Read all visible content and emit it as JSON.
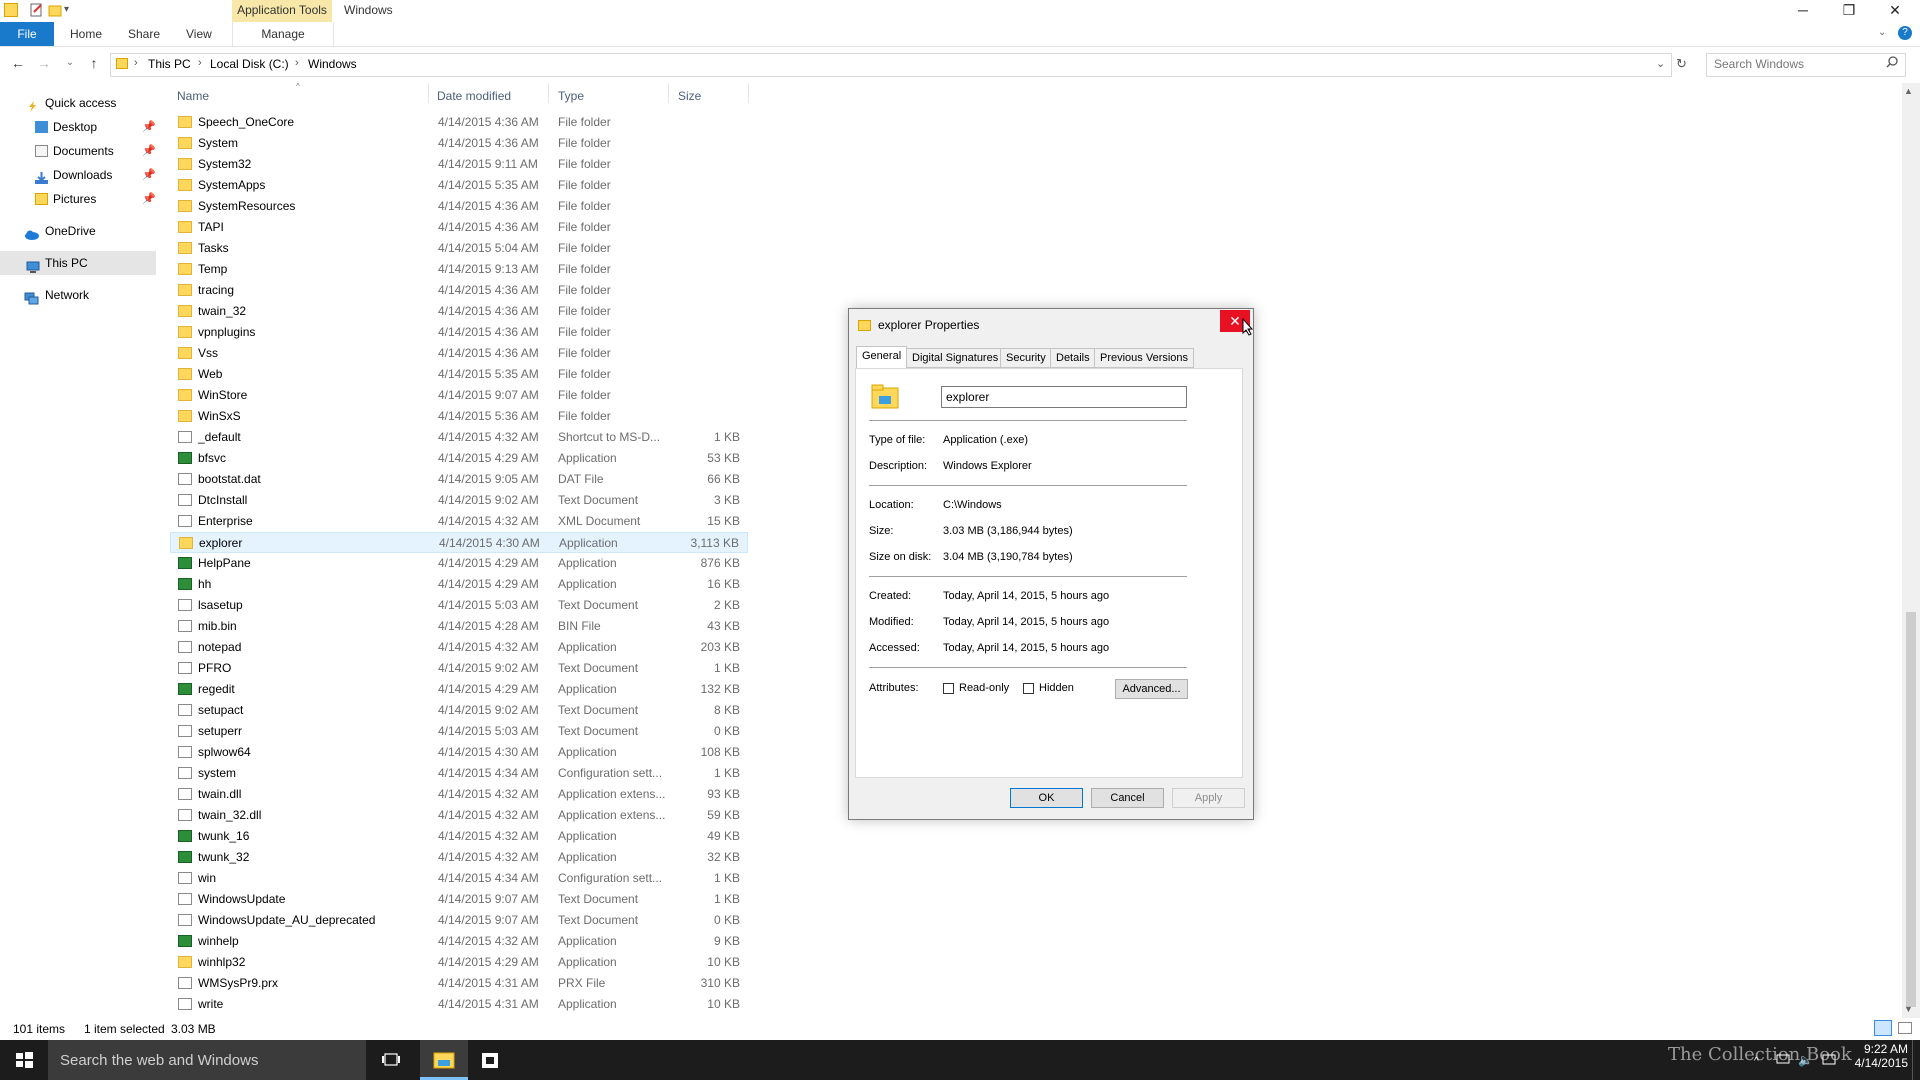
{
  "window": {
    "contextual_tab": "Application Tools",
    "title": "Windows",
    "minimize": "─",
    "maximize": "❐",
    "close": "✕"
  },
  "ribbon": {
    "tabs": [
      "File",
      "Home",
      "Share",
      "View"
    ],
    "manage": "Manage"
  },
  "address": {
    "crumbs": [
      "This PC",
      "Local Disk (C:)",
      "Windows"
    ],
    "search_placeholder": "Search Windows"
  },
  "nav": {
    "quick_access": "Quick access",
    "pinned": [
      "Desktop",
      "Documents",
      "Downloads",
      "Pictures"
    ],
    "onedrive": "OneDrive",
    "this_pc": "This PC",
    "network": "Network"
  },
  "columns": {
    "name": "Name",
    "date": "Date modified",
    "type": "Type",
    "size": "Size"
  },
  "files": [
    {
      "name": "Speech_OneCore",
      "date": "4/14/2015 4:36 AM",
      "type": "File folder",
      "size": "",
      "kind": "folder"
    },
    {
      "name": "System",
      "date": "4/14/2015 4:36 AM",
      "type": "File folder",
      "size": "",
      "kind": "folder"
    },
    {
      "name": "System32",
      "date": "4/14/2015 9:11 AM",
      "type": "File folder",
      "size": "",
      "kind": "folder"
    },
    {
      "name": "SystemApps",
      "date": "4/14/2015 5:35 AM",
      "type": "File folder",
      "size": "",
      "kind": "folder"
    },
    {
      "name": "SystemResources",
      "date": "4/14/2015 4:36 AM",
      "type": "File folder",
      "size": "",
      "kind": "folder"
    },
    {
      "name": "TAPI",
      "date": "4/14/2015 4:36 AM",
      "type": "File folder",
      "size": "",
      "kind": "folder"
    },
    {
      "name": "Tasks",
      "date": "4/14/2015 5:04 AM",
      "type": "File folder",
      "size": "",
      "kind": "folder"
    },
    {
      "name": "Temp",
      "date": "4/14/2015 9:13 AM",
      "type": "File folder",
      "size": "",
      "kind": "folder"
    },
    {
      "name": "tracing",
      "date": "4/14/2015 4:36 AM",
      "type": "File folder",
      "size": "",
      "kind": "folder"
    },
    {
      "name": "twain_32",
      "date": "4/14/2015 4:36 AM",
      "type": "File folder",
      "size": "",
      "kind": "folder"
    },
    {
      "name": "vpnplugins",
      "date": "4/14/2015 4:36 AM",
      "type": "File folder",
      "size": "",
      "kind": "folder"
    },
    {
      "name": "Vss",
      "date": "4/14/2015 4:36 AM",
      "type": "File folder",
      "size": "",
      "kind": "folder"
    },
    {
      "name": "Web",
      "date": "4/14/2015 5:35 AM",
      "type": "File folder",
      "size": "",
      "kind": "folder"
    },
    {
      "name": "WinStore",
      "date": "4/14/2015 9:07 AM",
      "type": "File folder",
      "size": "",
      "kind": "folder"
    },
    {
      "name": "WinSxS",
      "date": "4/14/2015 5:36 AM",
      "type": "File folder",
      "size": "",
      "kind": "folder"
    },
    {
      "name": "_default",
      "date": "4/14/2015 4:32 AM",
      "type": "Shortcut to MS-D...",
      "size": "1 KB",
      "kind": "file"
    },
    {
      "name": "bfsvc",
      "date": "4/14/2015 4:29 AM",
      "type": "Application",
      "size": "53 KB",
      "kind": "app"
    },
    {
      "name": "bootstat.dat",
      "date": "4/14/2015 9:05 AM",
      "type": "DAT File",
      "size": "66 KB",
      "kind": "file"
    },
    {
      "name": "DtcInstall",
      "date": "4/14/2015 9:02 AM",
      "type": "Text Document",
      "size": "3 KB",
      "kind": "file"
    },
    {
      "name": "Enterprise",
      "date": "4/14/2015 4:32 AM",
      "type": "XML Document",
      "size": "15 KB",
      "kind": "file"
    },
    {
      "name": "explorer",
      "date": "4/14/2015 4:30 AM",
      "type": "Application",
      "size": "3,113 KB",
      "kind": "folder",
      "selected": true
    },
    {
      "name": "HelpPane",
      "date": "4/14/2015 4:29 AM",
      "type": "Application",
      "size": "876 KB",
      "kind": "app"
    },
    {
      "name": "hh",
      "date": "4/14/2015 4:29 AM",
      "type": "Application",
      "size": "16 KB",
      "kind": "app"
    },
    {
      "name": "lsasetup",
      "date": "4/14/2015 5:03 AM",
      "type": "Text Document",
      "size": "2 KB",
      "kind": "file"
    },
    {
      "name": "mib.bin",
      "date": "4/14/2015 4:28 AM",
      "type": "BIN File",
      "size": "43 KB",
      "kind": "file"
    },
    {
      "name": "notepad",
      "date": "4/14/2015 4:32 AM",
      "type": "Application",
      "size": "203 KB",
      "kind": "file"
    },
    {
      "name": "PFRO",
      "date": "4/14/2015 9:02 AM",
      "type": "Text Document",
      "size": "1 KB",
      "kind": "file"
    },
    {
      "name": "regedit",
      "date": "4/14/2015 4:29 AM",
      "type": "Application",
      "size": "132 KB",
      "kind": "app"
    },
    {
      "name": "setupact",
      "date": "4/14/2015 9:02 AM",
      "type": "Text Document",
      "size": "8 KB",
      "kind": "file"
    },
    {
      "name": "setuperr",
      "date": "4/14/2015 5:03 AM",
      "type": "Text Document",
      "size": "0 KB",
      "kind": "file"
    },
    {
      "name": "splwow64",
      "date": "4/14/2015 4:30 AM",
      "type": "Application",
      "size": "108 KB",
      "kind": "file"
    },
    {
      "name": "system",
      "date": "4/14/2015 4:34 AM",
      "type": "Configuration sett...",
      "size": "1 KB",
      "kind": "file"
    },
    {
      "name": "twain.dll",
      "date": "4/14/2015 4:32 AM",
      "type": "Application extens...",
      "size": "93 KB",
      "kind": "file"
    },
    {
      "name": "twain_32.dll",
      "date": "4/14/2015 4:32 AM",
      "type": "Application extens...",
      "size": "59 KB",
      "kind": "file"
    },
    {
      "name": "twunk_16",
      "date": "4/14/2015 4:32 AM",
      "type": "Application",
      "size": "49 KB",
      "kind": "app"
    },
    {
      "name": "twunk_32",
      "date": "4/14/2015 4:32 AM",
      "type": "Application",
      "size": "32 KB",
      "kind": "app"
    },
    {
      "name": "win",
      "date": "4/14/2015 4:34 AM",
      "type": "Configuration sett...",
      "size": "1 KB",
      "kind": "file"
    },
    {
      "name": "WindowsUpdate",
      "date": "4/14/2015 9:07 AM",
      "type": "Text Document",
      "size": "1 KB",
      "kind": "file"
    },
    {
      "name": "WindowsUpdate_AU_deprecated",
      "date": "4/14/2015 9:07 AM",
      "type": "Text Document",
      "size": "0 KB",
      "kind": "file"
    },
    {
      "name": "winhelp",
      "date": "4/14/2015 4:32 AM",
      "type": "Application",
      "size": "9 KB",
      "kind": "app"
    },
    {
      "name": "winhlp32",
      "date": "4/14/2015 4:29 AM",
      "type": "Application",
      "size": "10 KB",
      "kind": "folder"
    },
    {
      "name": "WMSysPr9.prx",
      "date": "4/14/2015 4:31 AM",
      "type": "PRX File",
      "size": "310 KB",
      "kind": "file"
    },
    {
      "name": "write",
      "date": "4/14/2015 4:31 AM",
      "type": "Application",
      "size": "10 KB",
      "kind": "file"
    }
  ],
  "status": {
    "count": "101 items",
    "selection": "1 item selected",
    "selection_size": "3.03 MB"
  },
  "dialog": {
    "title": "explorer Properties",
    "tabs": [
      "General",
      "Digital Signatures",
      "Security",
      "Details",
      "Previous Versions"
    ],
    "filename": "explorer",
    "type_label": "Type of file:",
    "type_value": "Application (.exe)",
    "desc_label": "Description:",
    "desc_value": "Windows Explorer",
    "location_label": "Location:",
    "location_value": "C:\\Windows",
    "size_label": "Size:",
    "size_value": "3.03 MB (3,186,944 bytes)",
    "disk_label": "Size on disk:",
    "disk_value": "3.04 MB (3,190,784 bytes)",
    "created_label": "Created:",
    "created_value": "Today, April 14, 2015, 5 hours ago",
    "modified_label": "Modified:",
    "modified_value": "Today, April 14, 2015, 5 hours ago",
    "accessed_label": "Accessed:",
    "accessed_value": "Today, April 14, 2015, 5 hours ago",
    "attributes_label": "Attributes:",
    "readonly_label": "Read-only",
    "hidden_label": "Hidden",
    "advanced_label": "Advanced...",
    "ok_label": "OK",
    "cancel_label": "Cancel",
    "apply_label": "Apply",
    "close_glyph": "✕"
  },
  "taskbar": {
    "search_placeholder": "Search the web and Windows",
    "watermark": "The Collection Book",
    "time": "9:22 AM",
    "date": "4/14/2015"
  }
}
